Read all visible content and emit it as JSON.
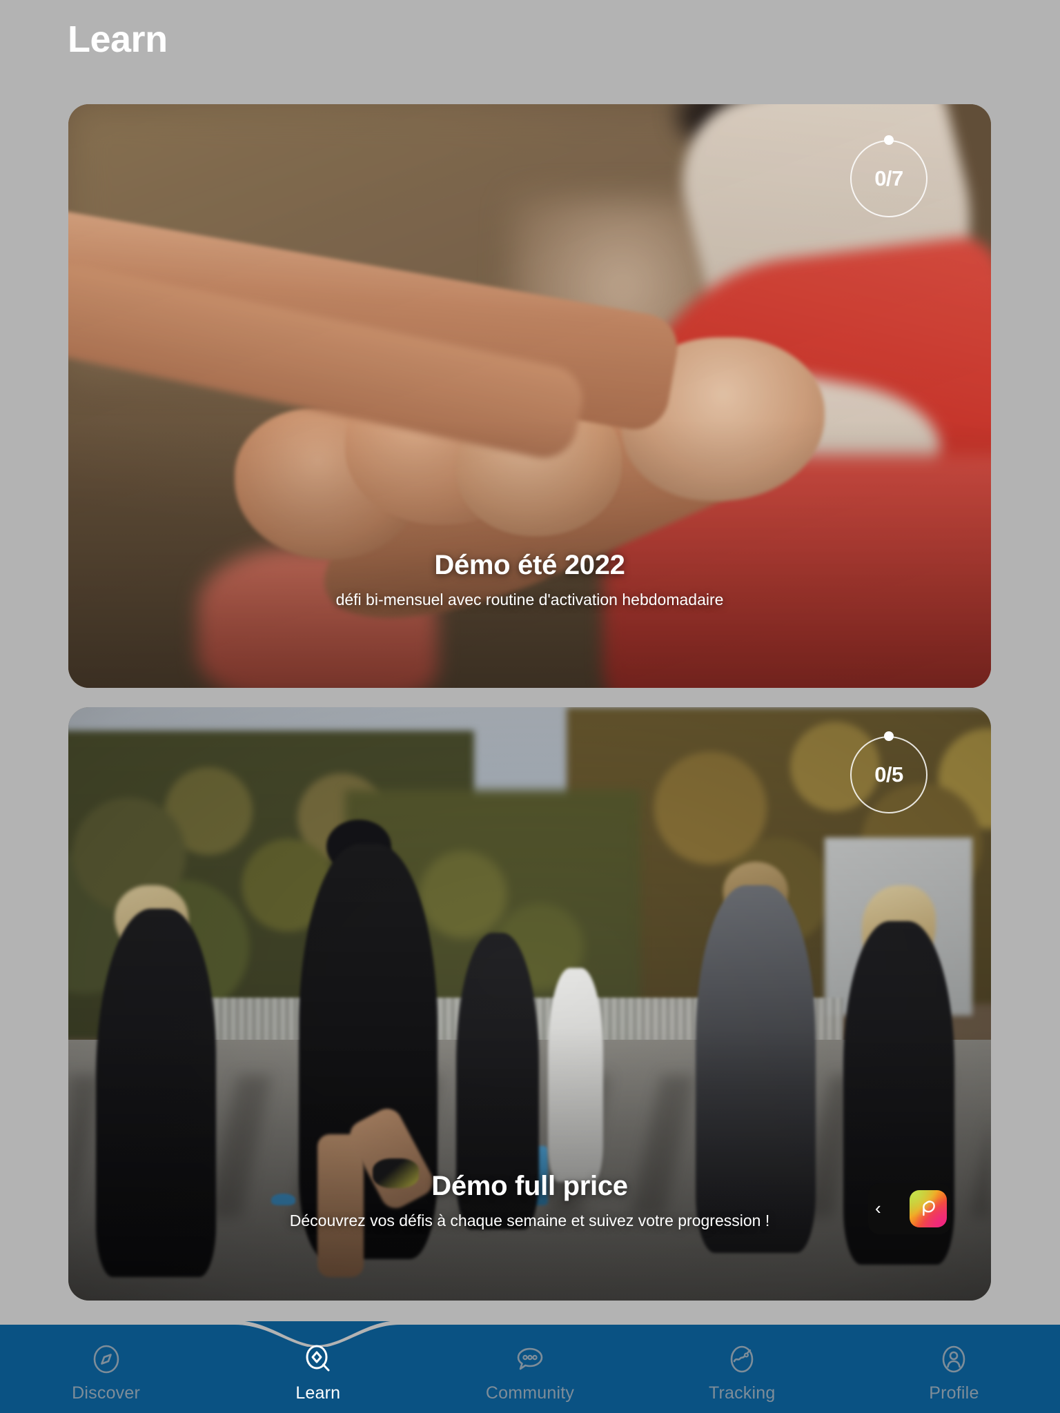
{
  "header": {
    "title": "Learn"
  },
  "colors": {
    "background": "#b3b3b3",
    "nav_bar": "#0a5283",
    "nav_active_text": "#ffffff",
    "nav_inactive_text": "#7e8d99",
    "card_text": "#ffffff",
    "widget_background": "#0d0d0d"
  },
  "cards": [
    {
      "title": "Démo été 2022",
      "subtitle": "défi bi-mensuel avec routine d'activation hebdomadaire",
      "progress": "0/7",
      "progress_completed": 0,
      "progress_total": 7,
      "image_alt": "team-huddle-hands-photo"
    },
    {
      "title": "Démo full price",
      "subtitle": "Découvrez vos défis à chaque semaine et suivez votre progression !",
      "progress": "0/5",
      "progress_completed": 0,
      "progress_total": 5,
      "image_alt": "outdoor-running-group-photo"
    }
  ],
  "floating_widget": {
    "back_glyph": "‹",
    "app_icon_name": "pulse-app-icon"
  },
  "bottom_nav": {
    "items": [
      {
        "label": "Discover",
        "icon": "compass-icon",
        "active": false
      },
      {
        "label": "Learn",
        "icon": "search-diamond-icon",
        "active": true
      },
      {
        "label": "Community",
        "icon": "chat-bubble-icon",
        "active": false
      },
      {
        "label": "Tracking",
        "icon": "activity-chart-icon",
        "active": false
      },
      {
        "label": "Profile",
        "icon": "user-circle-icon",
        "active": false
      }
    ]
  }
}
